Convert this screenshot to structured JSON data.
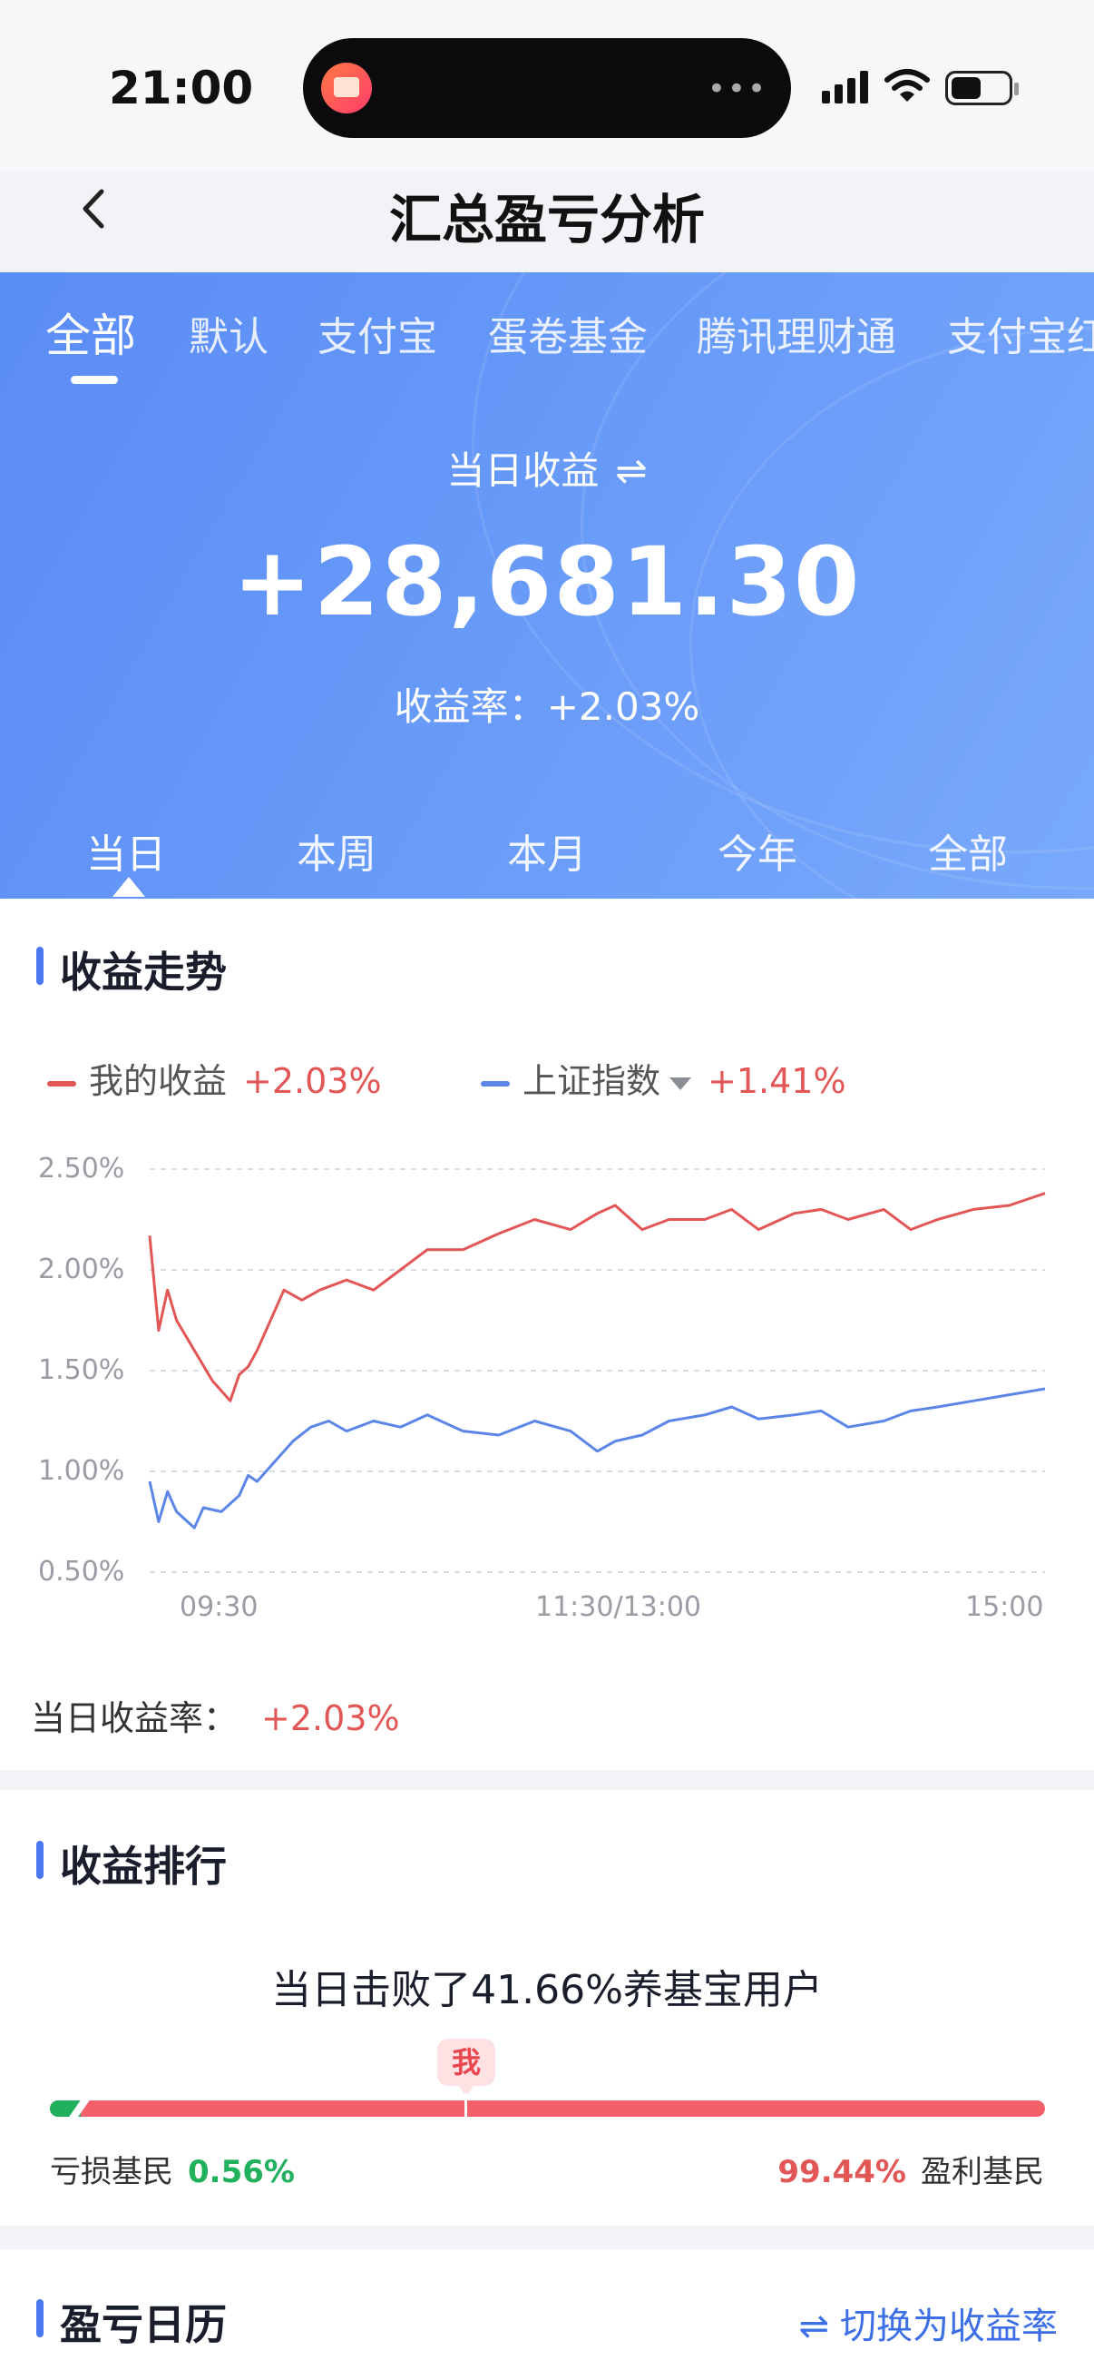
{
  "status_bar": {
    "time": "21:00"
  },
  "nav": {
    "title": "汇总盈亏分析"
  },
  "account_tabs": [
    "全部",
    "默认",
    "支付宝",
    "蛋卷基金",
    "腾讯理财通",
    "支付宝红"
  ],
  "hero": {
    "label": "当日收益",
    "swap_icon": "⇌",
    "value": "+28,681.30",
    "rate_label": "收益率：",
    "rate_value": "+2.03%"
  },
  "period_tabs": [
    "当日",
    "本周",
    "本月",
    "今年",
    "全部"
  ],
  "trend": {
    "title": "收益走势",
    "legend": [
      {
        "name": "我的收益",
        "value": "+2.03%",
        "color": "#e25656"
      },
      {
        "name": "上证指数",
        "value": "+1.41%",
        "color": "#5b86e8"
      }
    ],
    "daily_label": "当日收益率：",
    "daily_value": "+2.03%"
  },
  "chart_data": {
    "type": "line",
    "x_ticks": [
      "09:30",
      "11:30/13:00",
      "15:00"
    ],
    "y_ticks": [
      "2.50%",
      "2.00%",
      "1.50%",
      "1.00%",
      "0.50%"
    ],
    "ylim": [
      0.5,
      2.5
    ],
    "grid": true,
    "series": [
      {
        "name": "我的收益",
        "color": "#e25656",
        "x": [
          0,
          0.01,
          0.02,
          0.03,
          0.05,
          0.07,
          0.09,
          0.1,
          0.11,
          0.12,
          0.13,
          0.15,
          0.17,
          0.19,
          0.22,
          0.25,
          0.28,
          0.31,
          0.35,
          0.39,
          0.43,
          0.47,
          0.5,
          0.52,
          0.55,
          0.58,
          0.62,
          0.65,
          0.68,
          0.72,
          0.75,
          0.78,
          0.82,
          0.85,
          0.88,
          0.92,
          0.96,
          1.0
        ],
        "values": [
          2.17,
          1.7,
          1.9,
          1.75,
          1.6,
          1.45,
          1.35,
          1.48,
          1.52,
          1.6,
          1.7,
          1.9,
          1.85,
          1.9,
          1.95,
          1.9,
          2.0,
          2.1,
          2.1,
          2.18,
          2.25,
          2.2,
          2.28,
          2.32,
          2.2,
          2.25,
          2.25,
          2.3,
          2.2,
          2.28,
          2.3,
          2.25,
          2.3,
          2.2,
          2.25,
          2.3,
          2.32,
          2.38
        ]
      },
      {
        "name": "上证指数",
        "color": "#5b86e8",
        "x": [
          0,
          0.01,
          0.02,
          0.03,
          0.05,
          0.06,
          0.08,
          0.1,
          0.11,
          0.12,
          0.14,
          0.16,
          0.18,
          0.2,
          0.22,
          0.25,
          0.28,
          0.31,
          0.35,
          0.39,
          0.43,
          0.47,
          0.5,
          0.52,
          0.55,
          0.58,
          0.62,
          0.65,
          0.68,
          0.72,
          0.75,
          0.78,
          0.82,
          0.85,
          0.88,
          0.92,
          0.96,
          1.0
        ],
        "values": [
          0.95,
          0.75,
          0.9,
          0.8,
          0.72,
          0.82,
          0.8,
          0.88,
          0.98,
          0.95,
          1.05,
          1.15,
          1.22,
          1.25,
          1.2,
          1.25,
          1.22,
          1.28,
          1.2,
          1.18,
          1.25,
          1.2,
          1.1,
          1.15,
          1.18,
          1.25,
          1.28,
          1.32,
          1.26,
          1.28,
          1.3,
          1.22,
          1.25,
          1.3,
          1.32,
          1.35,
          1.38,
          1.41
        ]
      }
    ]
  },
  "ranking": {
    "title": "收益排行",
    "text": "当日击败了41.66%养基宝用户",
    "me_label": "我",
    "me_position": 0.4166,
    "loss_label": "亏损基民",
    "loss_value": "0.56%",
    "gain_label": "盈利基民",
    "gain_value": "99.44%"
  },
  "calendar": {
    "title": "盈亏日历",
    "switch_label": "切换为收益率",
    "switch_icon": "⇌"
  }
}
